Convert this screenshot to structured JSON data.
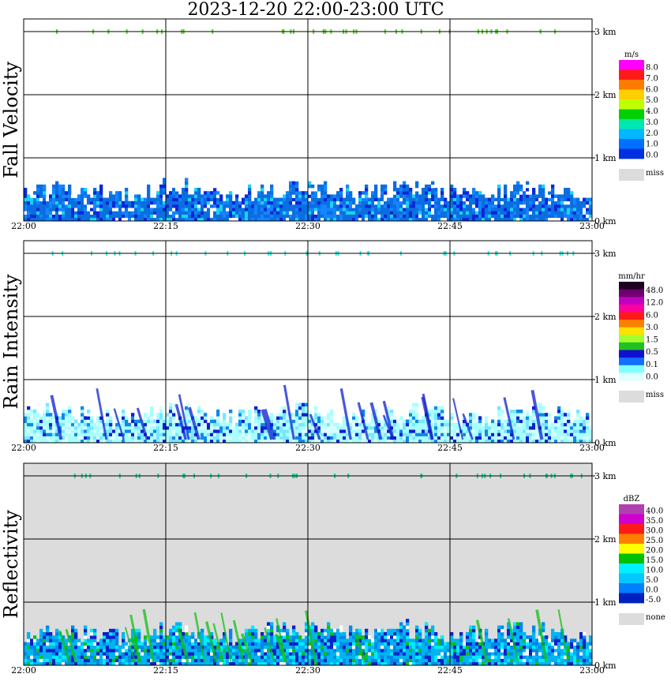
{
  "title": "2023-12-20   22:00-23:00 UTC",
  "chart_data": [
    {
      "type": "heatmap",
      "title": "Fall Velocity",
      "ylabel": "Fall Velocity",
      "x_ticks": [
        "22:00",
        "22:15",
        "22:30",
        "22:45",
        "23:00"
      ],
      "y_ticks": [
        "0 km",
        "1 km",
        "2 km",
        "3 km"
      ],
      "ylim": [
        0,
        3.2
      ],
      "grid": true,
      "background": "#ffffff",
      "colorbar": {
        "unit": "m/s",
        "labels": [
          "8.0",
          "7.0",
          "6.0",
          "5.0",
          "4.0",
          "3.0",
          "2.0",
          "1.0",
          "0.0"
        ],
        "colors": [
          "#ff00ff",
          "#ff1a1a",
          "#ff7a00",
          "#ffd000",
          "#bfff00",
          "#00d000",
          "#00e8b0",
          "#00b8ff",
          "#0070ff",
          "#0030e0"
        ],
        "miss_label": "miss",
        "miss_color": "#dcdcdc"
      },
      "fill_top_km": 0.65,
      "palette": [
        "#0a6ee0",
        "#1484ff",
        "#0a28d8",
        "#19d4f0",
        "#ffffff"
      ],
      "weights": [
        0.5,
        0.2,
        0.14,
        0.08,
        0.08
      ],
      "tops_color": "#55dd22"
    },
    {
      "type": "heatmap",
      "title": "Rain Intensity",
      "ylabel": "Rain Intensity",
      "x_ticks": [
        "22:00",
        "22:15",
        "22:30",
        "22:45",
        "23:00"
      ],
      "y_ticks": [
        "0 km",
        "1 km",
        "2 km",
        "3 km"
      ],
      "ylim": [
        0,
        3.2
      ],
      "grid": true,
      "background": "#ffffff",
      "colorbar": {
        "unit": "mm/hr",
        "labels": [
          "48.0",
          "12.0",
          "6.0",
          "3.0",
          "1.5",
          "0.5",
          "0.1",
          "0.0"
        ],
        "colors": [
          "#200020",
          "#700070",
          "#c000c0",
          "#ff00a0",
          "#ff1a1a",
          "#ff8000",
          "#ffe000",
          "#a0ff30",
          "#20c020",
          "#1010d0",
          "#1070ff",
          "#80ffff",
          "#e0ffff"
        ],
        "miss_label": "miss",
        "miss_color": "#dcdcdc"
      },
      "fill_top_km": 0.62,
      "palette": [
        "#a8ffff",
        "#d8ffff",
        "#7ae6ff",
        "#1088e8",
        "#1020d0"
      ],
      "weights": [
        0.45,
        0.2,
        0.17,
        0.1,
        0.08
      ],
      "tops_color": "#33eedd"
    },
    {
      "type": "heatmap",
      "title": "Reflectivity",
      "ylabel": "Reflectivity",
      "x_ticks": [
        "22:00",
        "22:15",
        "22:30",
        "22:45",
        "23:00"
      ],
      "y_ticks": [
        "0 km",
        "1 km",
        "2 km",
        "3 km"
      ],
      "ylim": [
        0,
        3.2
      ],
      "grid": true,
      "background": "#dcdcdc",
      "colorbar": {
        "unit": "dBZ",
        "labels": [
          "40.0",
          "35.0",
          "30.0",
          "25.0",
          "20.0",
          "15.0",
          "10.0",
          "5.0",
          "0.0",
          "-5.0"
        ],
        "colors": [
          "#b040b0",
          "#d000d0",
          "#ff1a1a",
          "#ff8000",
          "#ffff00",
          "#00c000",
          "#00f0ff",
          "#00c8ff",
          "#0080ff",
          "#0020c0"
        ],
        "miss_label": "none",
        "miss_color": "#dcdcdc"
      },
      "fill_top_km": 0.7,
      "palette": [
        "#00b4f0",
        "#0088e8",
        "#1020c8",
        "#00ecff",
        "#10c010",
        "#ffffff"
      ],
      "weights": [
        0.38,
        0.2,
        0.16,
        0.14,
        0.06,
        0.06
      ],
      "tops_color": "#22cc99"
    }
  ]
}
